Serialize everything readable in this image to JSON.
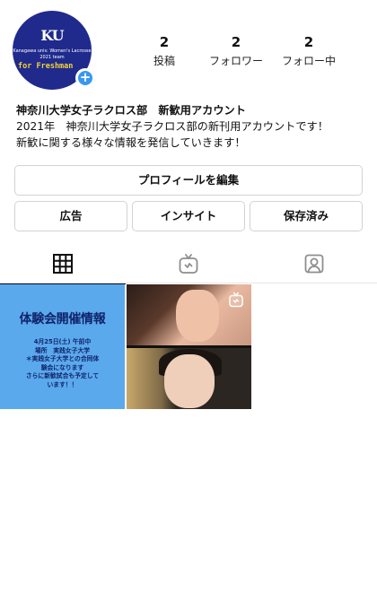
{
  "profile": {
    "avatar": {
      "logo": "KU",
      "line1": "Kanagawa univ. Women's Lacrosse",
      "line2": "2021 team",
      "tagline": "for Freshman"
    },
    "stats": [
      {
        "value": "2",
        "label": "投稿"
      },
      {
        "value": "2",
        "label": "フォロワー"
      },
      {
        "value": "2",
        "label": "フォロー中"
      }
    ],
    "bio": {
      "name": "神奈川大学女子ラクロス部　新歓用アカウント",
      "line1": "2021年　神奈川大学女子ラクロス部の新刊用アカウントです！",
      "line2": "新歓に関する様々な情報を発信していきます！"
    }
  },
  "buttons": {
    "edit_profile": "プロフィールを編集",
    "ads": "広告",
    "insights": "インサイト",
    "saved": "保存済み"
  },
  "tabs": [
    {
      "icon": "grid-icon",
      "active": true
    },
    {
      "icon": "igtv-icon",
      "active": false
    },
    {
      "icon": "tagged-icon",
      "active": false
    }
  ],
  "posts": [
    {
      "title": "体験会開催情報",
      "lines": [
        "4月25日(土) 午前中",
        "場所　実践女子大学",
        "＊実践女子大学との合同体",
        "験会になります",
        "さらに新歓試合も予定して",
        "います！！"
      ]
    },
    {
      "type": "igtv-video"
    }
  ],
  "colors": {
    "avatar_bg": "#1f2a8c",
    "accent_blue": "#3897f0",
    "post1_bg": "#5aa9ec",
    "post1_text": "#10236b",
    "tagline_yellow": "#f5d235"
  }
}
